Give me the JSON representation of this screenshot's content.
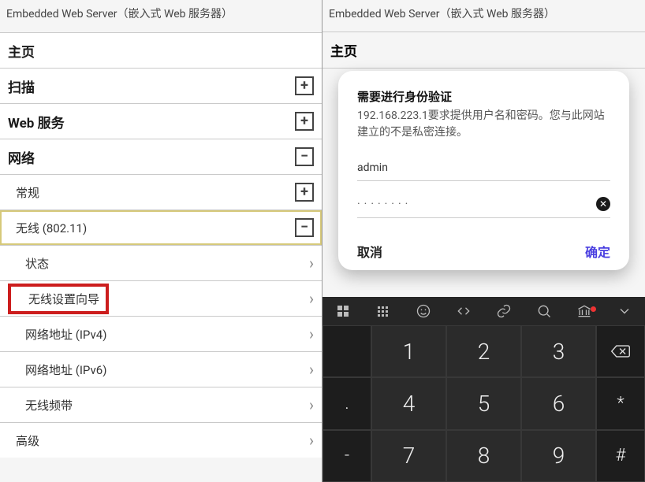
{
  "left": {
    "header": "Embedded Web Server（嵌入式 Web 服务器）",
    "items": {
      "home": "主页",
      "scan": "扫描",
      "webserv": "Web 服务",
      "network": "网络",
      "general": "常规",
      "wireless": "无线 (802.11)",
      "status": "状态",
      "wizard": "无线设置向导",
      "ipv4": "网络地址 (IPv4)",
      "ipv6": "网络地址 (IPv6)",
      "band": "无线频带",
      "advanced": "高级"
    },
    "icons": {
      "plus": "+",
      "minus": "−",
      "chev": "›"
    }
  },
  "right": {
    "header": "Embedded Web Server（嵌入式 Web 服务器）",
    "home": "主页",
    "dialog": {
      "title": "需要进行身份验证",
      "message": "192.168.223.1要求提供用户名和密码。您与此网站建立的不是私密连接。",
      "username": "admin",
      "password_dots": "········",
      "cancel": "取消",
      "ok": "确定"
    },
    "keypad": {
      "rows": [
        [
          "",
          "1",
          "2",
          "3",
          "bksp"
        ],
        [
          ".",
          "4",
          "5",
          "6",
          "*"
        ],
        [
          "-",
          "7",
          "8",
          "9",
          "#"
        ]
      ]
    }
  }
}
